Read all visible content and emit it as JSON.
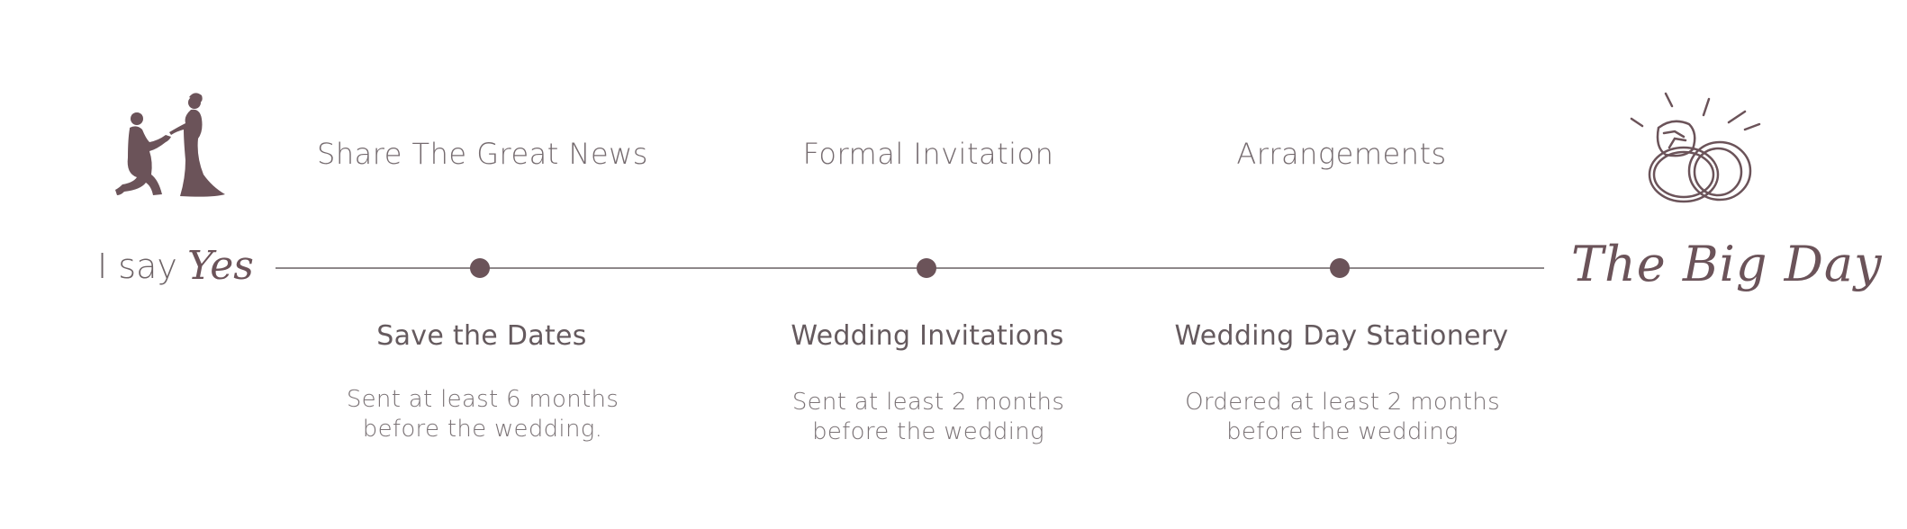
{
  "colors": {
    "accent": "#6b5359",
    "heading": "#655a5e",
    "body_text": "#7b7376",
    "line": "#8d8789",
    "background": "#ffffff"
  },
  "start": {
    "icon": "proposal-couple-silhouette-icon",
    "label_prefix": "I say",
    "label_script": "Yes"
  },
  "end": {
    "icon": "wedding-rings-icon",
    "label_script": "The Big Day"
  },
  "milestones": [
    {
      "phase": "Share The Great News",
      "title": "Save the Dates",
      "desc_line1": "Sent at least 6 months",
      "desc_line2": "before the wedding."
    },
    {
      "phase": "Formal Invitation",
      "title": "Wedding Invitations",
      "desc_line1": "Sent at least 2 months",
      "desc_line2": "before the wedding"
    },
    {
      "phase": "Arrangements",
      "title": "Wedding Day Stationery",
      "desc_line1": "Ordered at least 2 months",
      "desc_line2": "before the wedding"
    }
  ]
}
